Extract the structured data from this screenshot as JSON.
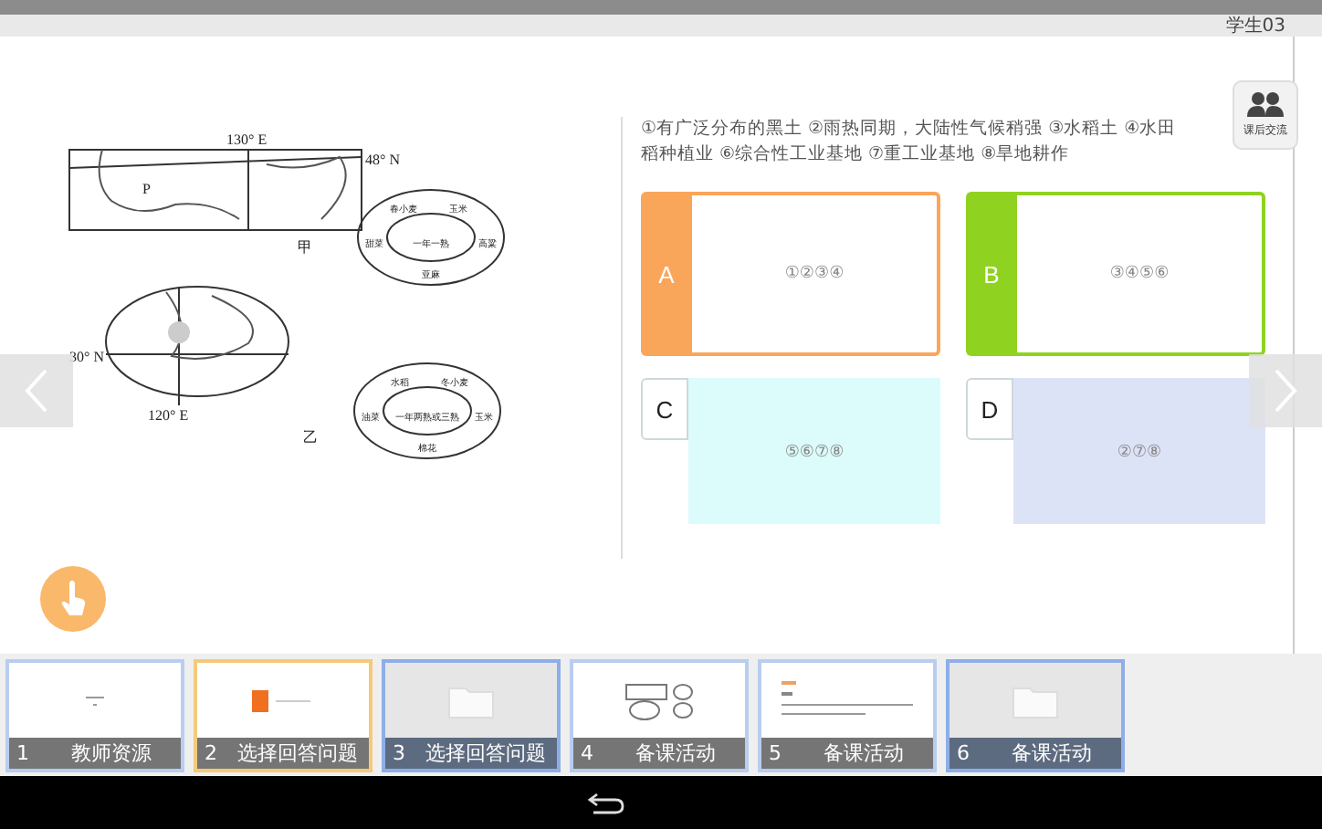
{
  "header": {
    "user": "学生03"
  },
  "figure": {
    "labels": {
      "lon_top": "130° E",
      "lat_top": "48° N",
      "point": "P",
      "map_a": "甲",
      "lat_bottom": "30° N",
      "lon_bottom": "120° E",
      "map_b": "乙"
    },
    "wheels": [
      {
        "center": "一年一熟",
        "sectors": [
          "春小麦",
          "玉米",
          "甜菜",
          "高粱",
          "亚麻"
        ]
      },
      {
        "center": "一年两熟或三熟",
        "sectors": [
          "水稻",
          "冬小麦",
          "油菜",
          "玉米",
          "棉花"
        ]
      }
    ]
  },
  "question": {
    "lines": [
      "①有广泛分布的黑土 ②雨热同期，大陆性气候稍强 ③水稻土 ④水田",
      "稻种植业 ⑥综合性工业基地 ⑦重工业基地 ⑧旱地耕作"
    ],
    "options": [
      {
        "label": "A",
        "answer": "①②③④",
        "selected": true,
        "color": "#f9a65a"
      },
      {
        "label": "B",
        "answer": "③④⑤⑥",
        "selected": true,
        "color": "#8fd320"
      },
      {
        "label": "C",
        "answer": "⑤⑥⑦⑧",
        "selected": false,
        "color": "#dcfbfb"
      },
      {
        "label": "D",
        "answer": "②⑦⑧",
        "selected": false,
        "color": "#dde3f7"
      }
    ]
  },
  "chat_button": {
    "label": "课后交流"
  },
  "thumbnails": [
    {
      "number": "1",
      "title": "教师资源",
      "kind": "blank",
      "selected": false
    },
    {
      "number": "2",
      "title": "选择回答问题",
      "kind": "choice",
      "selected": true
    },
    {
      "number": "3",
      "title": "选择回答问题",
      "kind": "folder",
      "selected": false
    },
    {
      "number": "4",
      "title": "备课活动",
      "kind": "map",
      "selected": false
    },
    {
      "number": "5",
      "title": "备课活动",
      "kind": "text",
      "selected": false
    },
    {
      "number": "6",
      "title": "备课活动",
      "kind": "folder",
      "selected": false
    }
  ]
}
